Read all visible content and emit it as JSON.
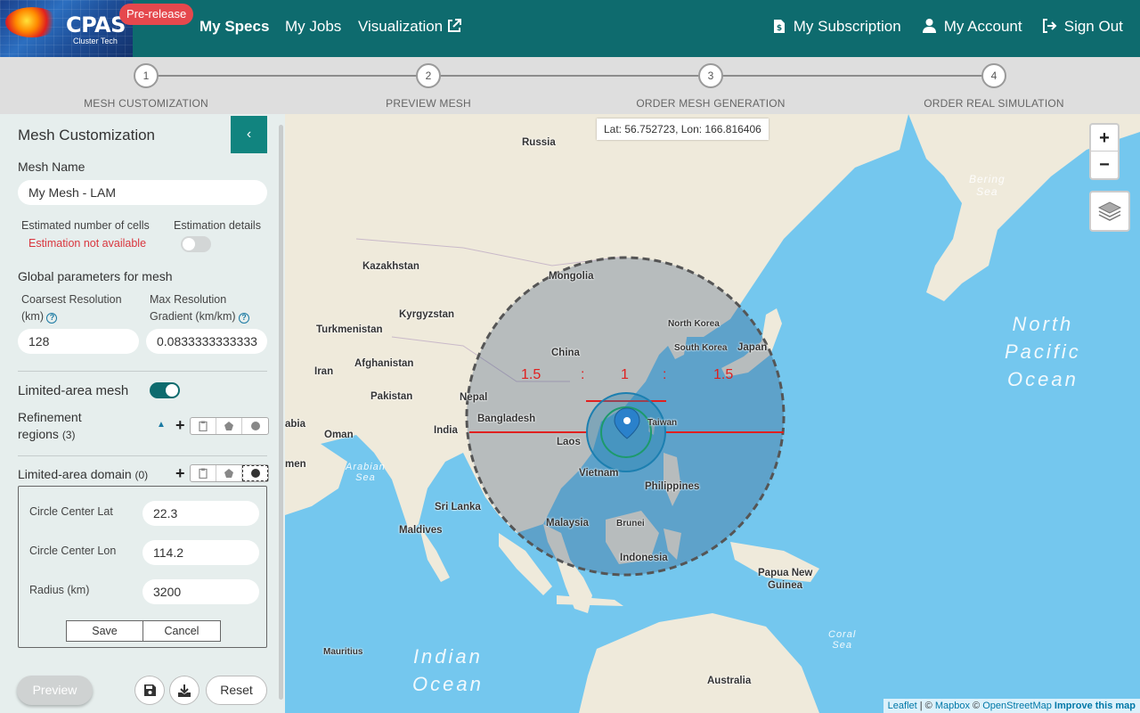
{
  "navbar": {
    "logo_text": "CPAS",
    "logo_sub": "Cluster Tech",
    "badge": "Pre-release",
    "links": {
      "my_specs": "My Specs",
      "my_jobs": "My Jobs",
      "visualization": "Visualization",
      "subscription": "My Subscription",
      "account": "My Account",
      "sign_out": "Sign Out"
    }
  },
  "stepper": {
    "steps": [
      {
        "num": "1",
        "label": "MESH CUSTOMIZATION"
      },
      {
        "num": "2",
        "label": "PREVIEW MESH"
      },
      {
        "num": "3",
        "label": "ORDER MESH GENERATION"
      },
      {
        "num": "4",
        "label": "ORDER REAL SIMULATION"
      }
    ]
  },
  "sidebar": {
    "title": "Mesh Customization",
    "mesh_name_label": "Mesh Name",
    "mesh_name_value": "My Mesh - LAM",
    "est_cells_label": "Estimated number of cells",
    "est_cells_error": "Estimation not available",
    "est_details_label": "Estimation details",
    "global_params_label": "Global parameters for mesh",
    "coarsest_label_1": "Coarsest Resolution",
    "coarsest_label_2": "(km)",
    "coarsest_value": "128",
    "gradient_label_1": "Max Resolution",
    "gradient_label_2": "Gradient (km/km)",
    "gradient_value": "0.0833333333333",
    "limited_area_label": "Limited-area mesh",
    "refinement_label_1": "Refinement",
    "refinement_label_2": "regions",
    "refinement_count": "(3)",
    "domain_label": "Limited-area domain",
    "domain_count": "(0)",
    "domain_form": {
      "lat_label": "Circle Center Lat",
      "lat_value": "22.3",
      "lon_label": "Circle Center Lon",
      "lon_value": "114.2",
      "radius_label": "Radius (km)",
      "radius_value": "3200",
      "save": "Save",
      "cancel": "Cancel"
    },
    "preview_button": "Preview",
    "reset_button": "Reset"
  },
  "map": {
    "coords_readout": "Lat: 56.752723, Lon: 166.816406",
    "zoom_in": "+",
    "zoom_out": "−",
    "ratio_left": "1.5",
    "ratio_colon_1": ":",
    "ratio_mid": "1",
    "ratio_colon_2": ":",
    "ratio_right": "1.5",
    "places": {
      "russia": "Russia",
      "kazakhstan": "Kazakhstan",
      "mongolia": "Mongolia",
      "kyrgyzstan": "Kyrgyzstan",
      "turkmenistan": "Turkmenistan",
      "afghanistan": "Afghanistan",
      "iran": "Iran",
      "pakistan": "Pakistan",
      "china": "China",
      "north_korea": "North Korea",
      "south_korea": "South Korea",
      "japan": "Japan",
      "nepal": "Nepal",
      "bangladesh": "Bangladesh",
      "india": "India",
      "oman": "Oman",
      "arabia": "abia",
      "yemen": "men",
      "laos": "Laos",
      "taiwan": "Taiwan",
      "vietnam": "Vietnam",
      "philippines": "Philippines",
      "sri_lanka": "Sri Lanka",
      "maldives": "Maldives",
      "malaysia": "Malaysia",
      "brunei": "Brunei",
      "indonesia": "Indonesia",
      "papua_1": "Papua New",
      "papua_2": "Guinea",
      "mauritius": "Mauritius",
      "australia": "Australia"
    },
    "seas": {
      "bering_1": "Bering",
      "bering_2": "Sea",
      "arabian_1": "Arabian",
      "arabian_2": "Sea",
      "coral_1": "Coral",
      "coral_2": "Sea",
      "north_pacific_1": "North",
      "north_pacific_2": "Pacific",
      "north_pacific_3": "Ocean",
      "indian_1": "Indian",
      "indian_2": "Ocean"
    },
    "attribution": {
      "leaflet": "Leaflet",
      "sep1": " | © ",
      "mapbox": "Mapbox",
      "sep2": " © ",
      "osm": "OpenStreetMap",
      "improve": "Improve this map"
    },
    "colors": {
      "ocean": "#74c7ee",
      "land": "#efeadb",
      "circle_stroke": "#555555",
      "ratio_line": "#e0201f",
      "inner_circle": "#1c7fb0",
      "core_circle": "#1d9a6c"
    }
  },
  "colors": {
    "navbar": "#0e6b6e",
    "accent": "#11847f",
    "badge": "#e5484d",
    "error": "#d9363e"
  }
}
